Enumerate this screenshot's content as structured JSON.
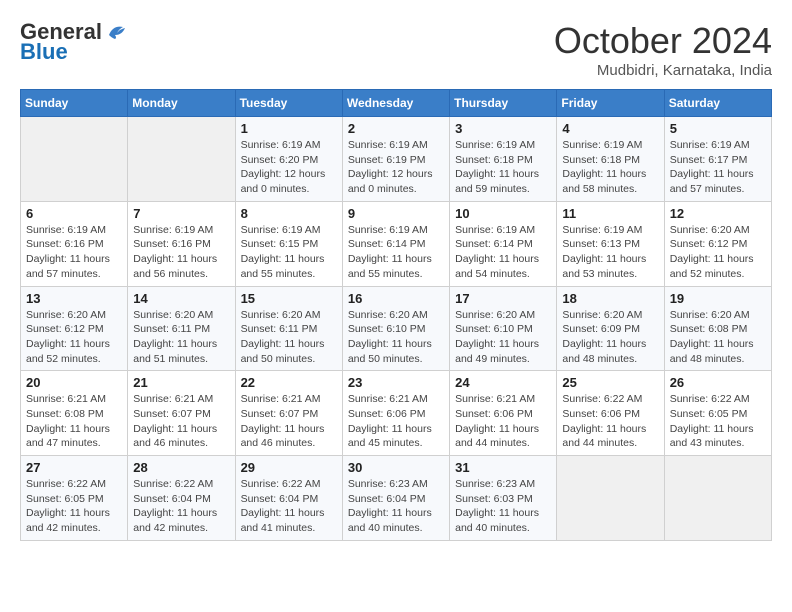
{
  "header": {
    "logo_general": "General",
    "logo_blue": "Blue",
    "month_title": "October 2024",
    "location": "Mudbidri, Karnataka, India"
  },
  "weekdays": [
    "Sunday",
    "Monday",
    "Tuesday",
    "Wednesday",
    "Thursday",
    "Friday",
    "Saturday"
  ],
  "weeks": [
    [
      {
        "day": "",
        "info": ""
      },
      {
        "day": "",
        "info": ""
      },
      {
        "day": "1",
        "info": "Sunrise: 6:19 AM\nSunset: 6:20 PM\nDaylight: 12 hours\nand 0 minutes."
      },
      {
        "day": "2",
        "info": "Sunrise: 6:19 AM\nSunset: 6:19 PM\nDaylight: 12 hours\nand 0 minutes."
      },
      {
        "day": "3",
        "info": "Sunrise: 6:19 AM\nSunset: 6:18 PM\nDaylight: 11 hours\nand 59 minutes."
      },
      {
        "day": "4",
        "info": "Sunrise: 6:19 AM\nSunset: 6:18 PM\nDaylight: 11 hours\nand 58 minutes."
      },
      {
        "day": "5",
        "info": "Sunrise: 6:19 AM\nSunset: 6:17 PM\nDaylight: 11 hours\nand 57 minutes."
      }
    ],
    [
      {
        "day": "6",
        "info": "Sunrise: 6:19 AM\nSunset: 6:16 PM\nDaylight: 11 hours\nand 57 minutes."
      },
      {
        "day": "7",
        "info": "Sunrise: 6:19 AM\nSunset: 6:16 PM\nDaylight: 11 hours\nand 56 minutes."
      },
      {
        "day": "8",
        "info": "Sunrise: 6:19 AM\nSunset: 6:15 PM\nDaylight: 11 hours\nand 55 minutes."
      },
      {
        "day": "9",
        "info": "Sunrise: 6:19 AM\nSunset: 6:14 PM\nDaylight: 11 hours\nand 55 minutes."
      },
      {
        "day": "10",
        "info": "Sunrise: 6:19 AM\nSunset: 6:14 PM\nDaylight: 11 hours\nand 54 minutes."
      },
      {
        "day": "11",
        "info": "Sunrise: 6:19 AM\nSunset: 6:13 PM\nDaylight: 11 hours\nand 53 minutes."
      },
      {
        "day": "12",
        "info": "Sunrise: 6:20 AM\nSunset: 6:12 PM\nDaylight: 11 hours\nand 52 minutes."
      }
    ],
    [
      {
        "day": "13",
        "info": "Sunrise: 6:20 AM\nSunset: 6:12 PM\nDaylight: 11 hours\nand 52 minutes."
      },
      {
        "day": "14",
        "info": "Sunrise: 6:20 AM\nSunset: 6:11 PM\nDaylight: 11 hours\nand 51 minutes."
      },
      {
        "day": "15",
        "info": "Sunrise: 6:20 AM\nSunset: 6:11 PM\nDaylight: 11 hours\nand 50 minutes."
      },
      {
        "day": "16",
        "info": "Sunrise: 6:20 AM\nSunset: 6:10 PM\nDaylight: 11 hours\nand 50 minutes."
      },
      {
        "day": "17",
        "info": "Sunrise: 6:20 AM\nSunset: 6:10 PM\nDaylight: 11 hours\nand 49 minutes."
      },
      {
        "day": "18",
        "info": "Sunrise: 6:20 AM\nSunset: 6:09 PM\nDaylight: 11 hours\nand 48 minutes."
      },
      {
        "day": "19",
        "info": "Sunrise: 6:20 AM\nSunset: 6:08 PM\nDaylight: 11 hours\nand 48 minutes."
      }
    ],
    [
      {
        "day": "20",
        "info": "Sunrise: 6:21 AM\nSunset: 6:08 PM\nDaylight: 11 hours\nand 47 minutes."
      },
      {
        "day": "21",
        "info": "Sunrise: 6:21 AM\nSunset: 6:07 PM\nDaylight: 11 hours\nand 46 minutes."
      },
      {
        "day": "22",
        "info": "Sunrise: 6:21 AM\nSunset: 6:07 PM\nDaylight: 11 hours\nand 46 minutes."
      },
      {
        "day": "23",
        "info": "Sunrise: 6:21 AM\nSunset: 6:06 PM\nDaylight: 11 hours\nand 45 minutes."
      },
      {
        "day": "24",
        "info": "Sunrise: 6:21 AM\nSunset: 6:06 PM\nDaylight: 11 hours\nand 44 minutes."
      },
      {
        "day": "25",
        "info": "Sunrise: 6:22 AM\nSunset: 6:06 PM\nDaylight: 11 hours\nand 44 minutes."
      },
      {
        "day": "26",
        "info": "Sunrise: 6:22 AM\nSunset: 6:05 PM\nDaylight: 11 hours\nand 43 minutes."
      }
    ],
    [
      {
        "day": "27",
        "info": "Sunrise: 6:22 AM\nSunset: 6:05 PM\nDaylight: 11 hours\nand 42 minutes."
      },
      {
        "day": "28",
        "info": "Sunrise: 6:22 AM\nSunset: 6:04 PM\nDaylight: 11 hours\nand 42 minutes."
      },
      {
        "day": "29",
        "info": "Sunrise: 6:22 AM\nSunset: 6:04 PM\nDaylight: 11 hours\nand 41 minutes."
      },
      {
        "day": "30",
        "info": "Sunrise: 6:23 AM\nSunset: 6:04 PM\nDaylight: 11 hours\nand 40 minutes."
      },
      {
        "day": "31",
        "info": "Sunrise: 6:23 AM\nSunset: 6:03 PM\nDaylight: 11 hours\nand 40 minutes."
      },
      {
        "day": "",
        "info": ""
      },
      {
        "day": "",
        "info": ""
      }
    ]
  ]
}
